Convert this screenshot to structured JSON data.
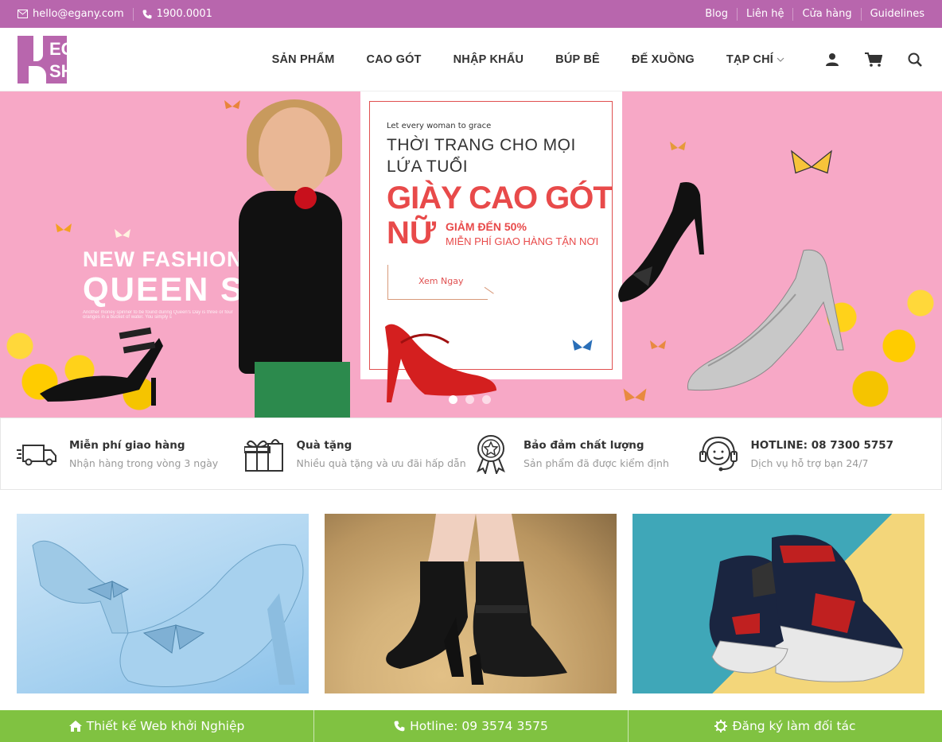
{
  "topbar": {
    "email": "hello@egany.com",
    "phone": "1900.0001",
    "links": [
      "Blog",
      "Liên hệ",
      "Cửa hàng",
      "Guidelines"
    ]
  },
  "header": {
    "logo": {
      "line1": "EGA",
      "line2": "SHOES"
    },
    "nav": [
      "SẢN PHẨM",
      "CAO GÓT",
      "NHẬP KHẨU",
      "BÚP BÊ",
      "ĐẾ XUỒNG",
      "TẠP CHÍ"
    ],
    "icons": [
      "user-icon",
      "cart-icon",
      "search-icon"
    ]
  },
  "hero": {
    "fashion_line1": "NEW FASHION",
    "fashion_line2": "QUEEN S",
    "fashion_small": "Another money spinner to be found during Queen's Day is three or four oranges in a bucket of water. You simply s",
    "card_small": "Let every woman to grace",
    "card_title": "THỜI TRANG CHO MỌI LỨA TUỔI",
    "card_big": "GIÀY CAO GÓT",
    "card_nu": "NỮ",
    "card_sale": "GIẢM ĐẾN 50%",
    "card_ship": "MIỄN PHÍ GIAO HÀNG TẬN NƠI",
    "card_button": "Xem Ngay",
    "slides": 3,
    "active_slide": 0
  },
  "features": [
    {
      "icon": "truck-icon",
      "title": "Miễn phí giao hàng",
      "subtitle": "Nhận hàng trong vòng 3 ngày"
    },
    {
      "icon": "gift-icon",
      "title": "Quà tặng",
      "subtitle": "Nhiều quà tặng và ưu đãi hấp dẫn"
    },
    {
      "icon": "award-icon",
      "title": "Bảo đảm chất lượng",
      "subtitle": "Sản phẩm đã được kiểm định"
    },
    {
      "icon": "headset-icon",
      "title": "HOTLINE: 08 7300 5757",
      "subtitle": "Dịch vụ hỗ trợ bạn 24/7"
    }
  ],
  "bottombar": [
    {
      "icon": "home-icon",
      "label": "Thiết kế Web khởi Nghiệp"
    },
    {
      "icon": "phone-icon",
      "label": "Hotline: 09 3574 3575"
    },
    {
      "icon": "gear-icon",
      "label": "Đăng ký làm đối tác"
    }
  ],
  "colors": {
    "brand": "#b866ad",
    "accent_red": "#e84a4a",
    "bottom_green": "#80c241"
  }
}
